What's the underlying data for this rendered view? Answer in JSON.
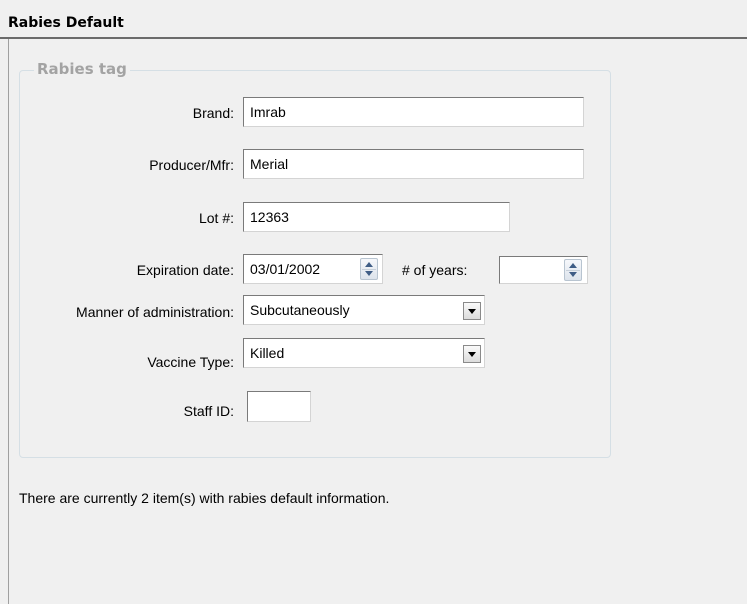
{
  "header": {
    "title": "Rabies Default"
  },
  "group": {
    "legend": "Rabies tag"
  },
  "fields": {
    "brand": {
      "label": "Brand:",
      "value": "Imrab"
    },
    "producer": {
      "label": "Producer/Mfr:",
      "value": "Merial"
    },
    "lot": {
      "label": "Lot #:",
      "value": "12363"
    },
    "expiration": {
      "label": "Expiration date:",
      "value": "03/01/2002"
    },
    "years": {
      "label": "# of years:",
      "value": ""
    },
    "manner": {
      "label": "Manner of administration:",
      "value": "Subcutaneously"
    },
    "vaccine": {
      "label": "Vaccine Type:",
      "value": "Killed"
    },
    "staff": {
      "label": "Staff ID:",
      "value": ""
    }
  },
  "info": {
    "text": "There are currently 2 item(s) with rabies default information."
  }
}
